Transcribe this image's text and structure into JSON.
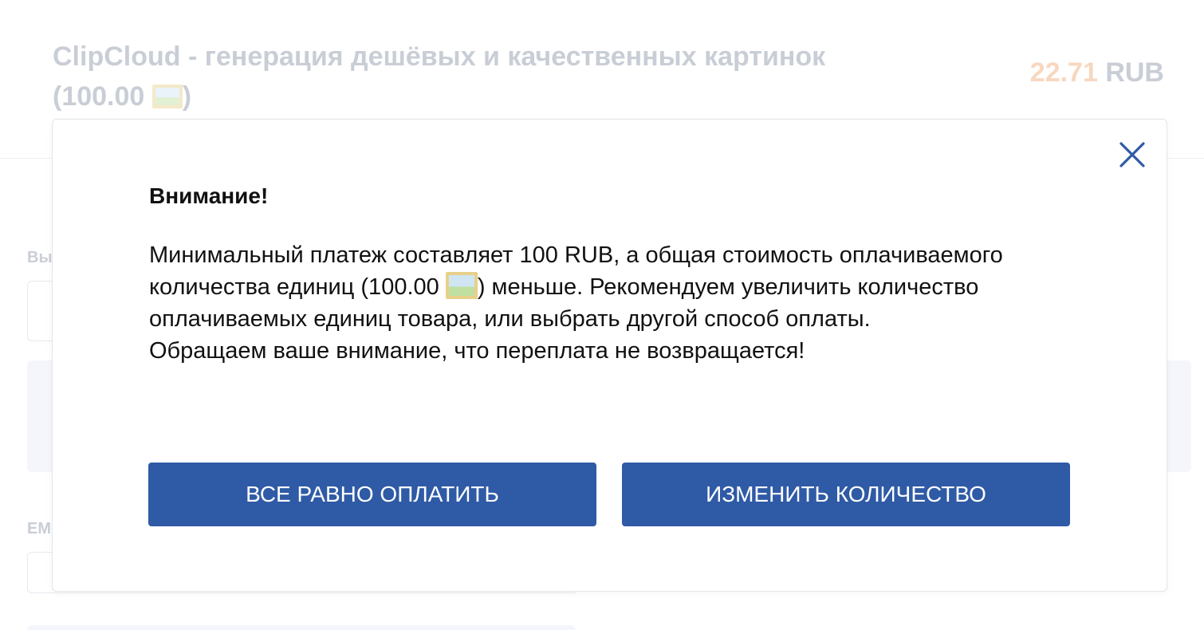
{
  "background": {
    "title": "ClipCloud - генерация дешёвых и качественных картинок",
    "title_units": "(100.00 ",
    "title_units_close": ")",
    "price_amount": "22.71",
    "price_currency": "RUB",
    "field_label_1": "Вы",
    "field_label_2": "EM"
  },
  "modal": {
    "heading": "Внимание!",
    "message_line1": "Минимальный платеж составляет 100 RUB, а общая стоимость оплачиваемого количества единиц (100.00 ",
    "message_line2": ") меньше. Рекомендуем увеличить количество оплачиваемых единиц товара, или выбрать другой способ оплаты.",
    "message_line3": "Обращаем ваше внимание, что переплата не возвращается!",
    "pay_anyway_label": "Все равно оплатить",
    "change_quantity_label": "Изменить количество",
    "close_icon": "close-icon",
    "unit_icon": "framed-picture-icon"
  },
  "colors": {
    "button_bg": "#2f5aa5",
    "close_icon": "#2f5aa5",
    "price_accent": "#f8d7bf"
  }
}
